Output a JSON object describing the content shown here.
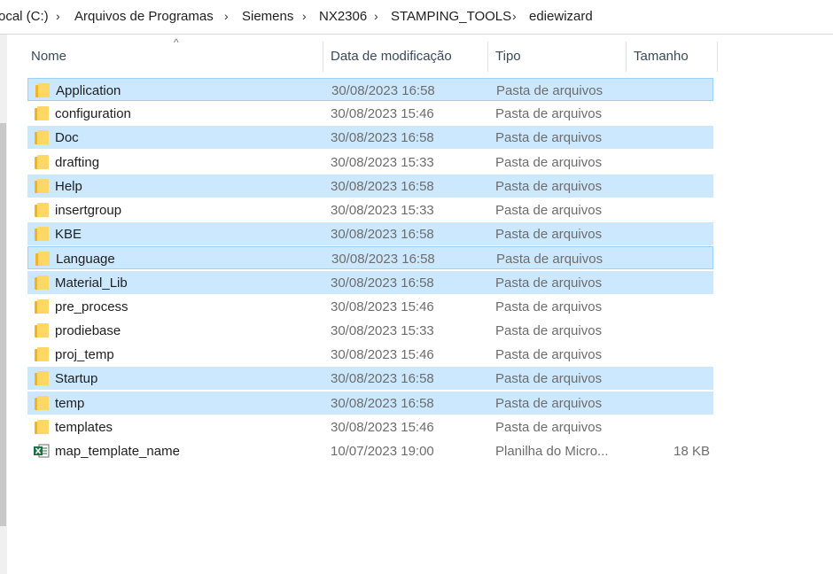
{
  "breadcrumb": {
    "segments": [
      "ocal (C:)",
      "Arquivos de Programas",
      "Siemens",
      "NX2306",
      "STAMPING_TOOLS",
      "ediewizard"
    ],
    "separator": "›"
  },
  "columns": {
    "name": "Nome",
    "date": "Data de modificação",
    "type": "Tipo",
    "size": "Tamanho",
    "sort_indicator": "^"
  },
  "files": [
    {
      "name": "Application",
      "date": "30/08/2023 16:58",
      "type": "Pasta de arquivos",
      "size": "",
      "icon": "folder-icon",
      "selected": true,
      "focused": true
    },
    {
      "name": "configuration",
      "date": "30/08/2023 15:46",
      "type": "Pasta de arquivos",
      "size": "",
      "icon": "folder-icon",
      "selected": false,
      "focused": false
    },
    {
      "name": "Doc",
      "date": "30/08/2023 16:58",
      "type": "Pasta de arquivos",
      "size": "",
      "icon": "folder-icon",
      "selected": true,
      "focused": false
    },
    {
      "name": "drafting",
      "date": "30/08/2023 15:33",
      "type": "Pasta de arquivos",
      "size": "",
      "icon": "folder-icon",
      "selected": false,
      "focused": false
    },
    {
      "name": "Help",
      "date": "30/08/2023 16:58",
      "type": "Pasta de arquivos",
      "size": "",
      "icon": "folder-icon",
      "selected": true,
      "focused": false
    },
    {
      "name": "insertgroup",
      "date": "30/08/2023 15:33",
      "type": "Pasta de arquivos",
      "size": "",
      "icon": "folder-icon",
      "selected": false,
      "focused": false
    },
    {
      "name": "KBE",
      "date": "30/08/2023 16:58",
      "type": "Pasta de arquivos",
      "size": "",
      "icon": "folder-icon",
      "selected": true,
      "focused": false
    },
    {
      "name": "Language",
      "date": "30/08/2023 16:58",
      "type": "Pasta de arquivos",
      "size": "",
      "icon": "folder-icon",
      "selected": true,
      "focused": true
    },
    {
      "name": "Material_Lib",
      "date": "30/08/2023 16:58",
      "type": "Pasta de arquivos",
      "size": "",
      "icon": "folder-icon",
      "selected": true,
      "focused": false
    },
    {
      "name": "pre_process",
      "date": "30/08/2023 15:46",
      "type": "Pasta de arquivos",
      "size": "",
      "icon": "folder-icon",
      "selected": false,
      "focused": false
    },
    {
      "name": "prodiebase",
      "date": "30/08/2023 15:33",
      "type": "Pasta de arquivos",
      "size": "",
      "icon": "folder-icon",
      "selected": false,
      "focused": false
    },
    {
      "name": "proj_temp",
      "date": "30/08/2023 15:46",
      "type": "Pasta de arquivos",
      "size": "",
      "icon": "folder-icon",
      "selected": false,
      "focused": false
    },
    {
      "name": "Startup",
      "date": "30/08/2023 16:58",
      "type": "Pasta de arquivos",
      "size": "",
      "icon": "folder-icon",
      "selected": true,
      "focused": false
    },
    {
      "name": "temp",
      "date": "30/08/2023 16:58",
      "type": "Pasta de arquivos",
      "size": "",
      "icon": "folder-icon",
      "selected": true,
      "focused": false
    },
    {
      "name": "templates",
      "date": "30/08/2023 15:46",
      "type": "Pasta de arquivos",
      "size": "",
      "icon": "folder-icon",
      "selected": false,
      "focused": false
    },
    {
      "name": "map_template_name",
      "date": "10/07/2023 19:00",
      "type": "Planilha do Micro...",
      "size": "18 KB",
      "icon": "excel-file-icon",
      "selected": false,
      "focused": false
    }
  ],
  "colors": {
    "selection": "#cce8ff",
    "selection_border": "#99d1ff",
    "folder": "#ffd766",
    "excel_green": "#1d7044"
  }
}
